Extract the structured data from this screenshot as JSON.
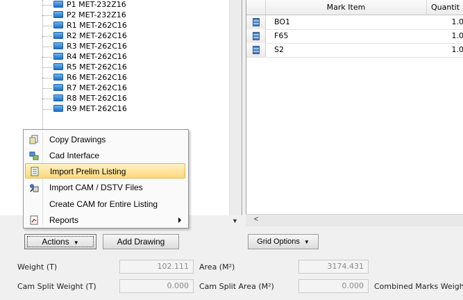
{
  "tree": {
    "items": [
      {
        "label": "P1  MET-232Z16"
      },
      {
        "label": "P2  MET-232Z16"
      },
      {
        "label": "R1  MET-262C16"
      },
      {
        "label": "R2  MET-262C16"
      },
      {
        "label": "R3  MET-262C16"
      },
      {
        "label": "R4  MET-262C16"
      },
      {
        "label": "R5  MET-262C16"
      },
      {
        "label": "R6  MET-262C16"
      },
      {
        "label": "R7  MET-262C16"
      },
      {
        "label": "R8  MET-262C16"
      },
      {
        "label": "R9  MET-262C16"
      }
    ]
  },
  "grid": {
    "columns": [
      "Mark Item",
      "Quantit"
    ],
    "rows": [
      {
        "mark": "BO1",
        "qty": "1.0"
      },
      {
        "mark": "F65",
        "qty": "1.0"
      },
      {
        "mark": "S2",
        "qty": "1.0"
      }
    ]
  },
  "context_menu": {
    "items": [
      {
        "label": "Copy Drawings",
        "icon": "copy-icon"
      },
      {
        "label": "Cad Interface",
        "icon": "cad-icon"
      },
      {
        "label": "Import Prelim Listing",
        "icon": "listing-icon"
      },
      {
        "label": "Import CAM / DSTV Files",
        "icon": "cam-icon"
      },
      {
        "label": "Create CAM for Entire Listing",
        "icon": ""
      },
      {
        "label": "Reports",
        "icon": "report-icon"
      }
    ]
  },
  "buttons": {
    "actions": "Actions",
    "add_drawing": "Add Drawing",
    "grid_options": "Grid Options"
  },
  "fields": {
    "weight_label": "Weight (T)",
    "weight_value": "102.111",
    "area_label": "Area (M²)",
    "area_value": "3174.431",
    "cam_weight_label": "Cam Split Weight (T)",
    "cam_weight_value": "0.000",
    "cam_area_label": "Cam Split Area (M²)",
    "cam_area_value": "0.000",
    "combined_label": "Combined Marks Weigh"
  },
  "colors": {
    "highlight": "#ffd97a",
    "tree_icon": "#1f6fc6"
  }
}
